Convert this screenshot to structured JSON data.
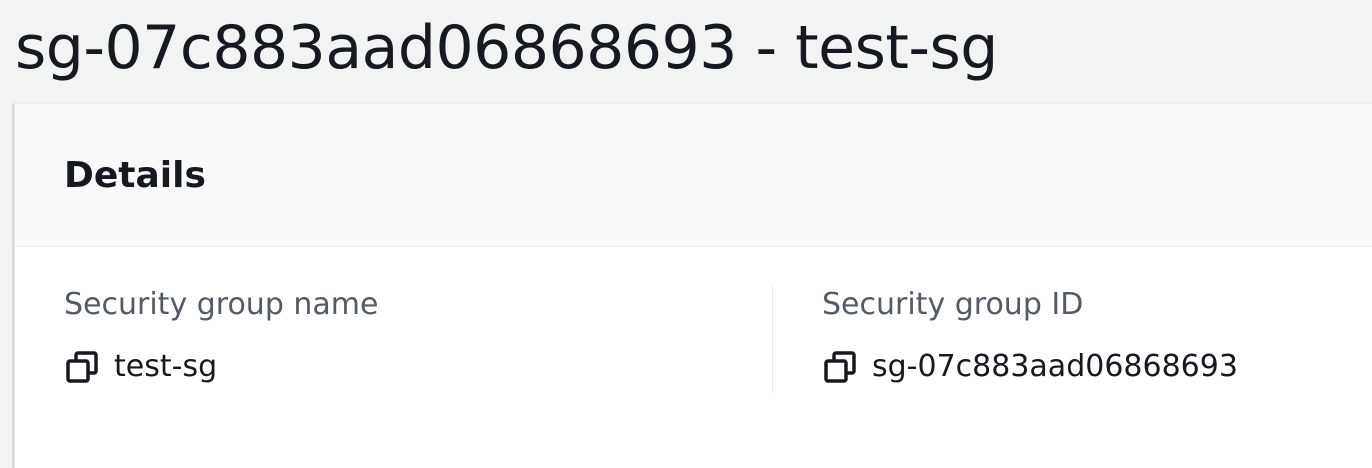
{
  "page": {
    "title": "sg-07c883aad06868693 - test-sg"
  },
  "details": {
    "title": "Details",
    "fields": [
      {
        "label": "Security group name",
        "value": "test-sg",
        "icon": "copy-icon"
      },
      {
        "label": "Security group ID",
        "value": "sg-07c883aad06868693",
        "icon": "copy-icon"
      }
    ]
  },
  "colors": {
    "page_bg": "#f2f3f3",
    "panel_bg": "#ffffff",
    "header_bg": "#fafafa",
    "text_primary": "#16191f",
    "text_label": "#545b64",
    "divider": "#eaeded"
  }
}
